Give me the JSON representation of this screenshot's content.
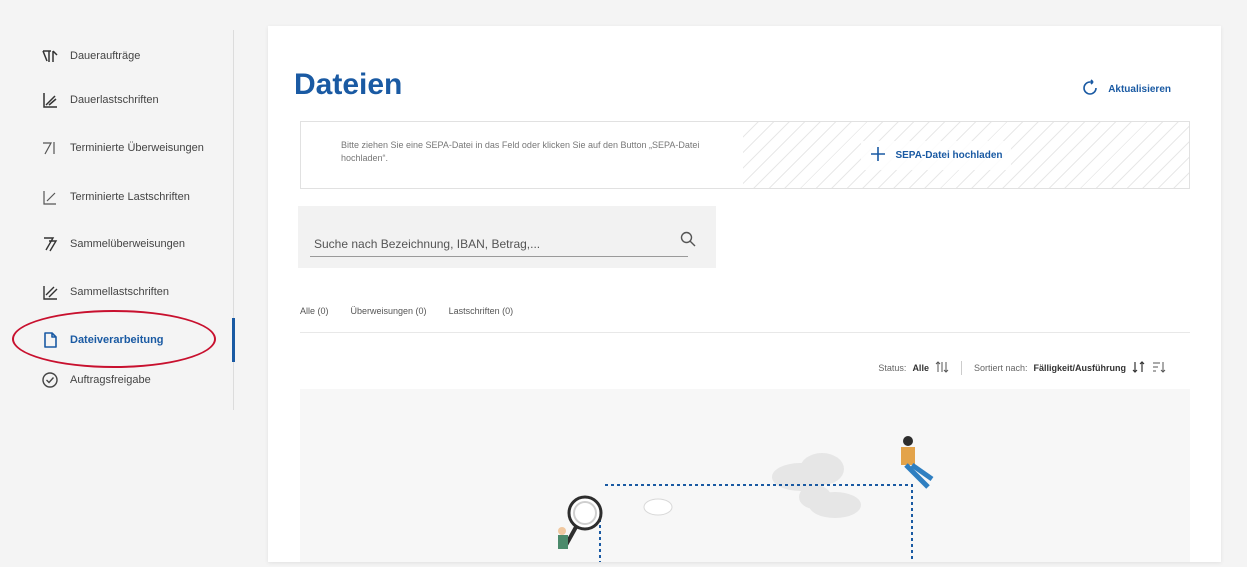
{
  "sidebar": {
    "items": [
      {
        "label": "Daueraufträge",
        "icon": "standing-order-icon"
      },
      {
        "label": "Dauerlastschriften",
        "icon": "standing-debit-icon"
      },
      {
        "label": "Terminierte Überweisungen",
        "icon": "scheduled-transfer-icon"
      },
      {
        "label": "Terminierte Lastschriften",
        "icon": "scheduled-debit-icon"
      },
      {
        "label": "Sammelüberweisungen",
        "icon": "bulk-transfer-icon"
      },
      {
        "label": "Sammellastschriften",
        "icon": "bulk-debit-icon"
      },
      {
        "label": "Dateiverarbeitung",
        "icon": "file-icon",
        "active": true
      },
      {
        "label": "Auftragsfreigabe",
        "icon": "check-circle-icon"
      }
    ]
  },
  "main": {
    "title": "Dateien",
    "refresh_label": "Aktualisieren",
    "dropzone": {
      "hint": "Bitte ziehen Sie eine SEPA-Datei in das Feld oder klicken Sie auf den Button „SEPA-Datei hochladen“.",
      "upload_label": "SEPA-Datei hochladen"
    },
    "search": {
      "placeholder": "Suche nach Bezeichnung, IBAN, Betrag,..."
    },
    "tabs": [
      {
        "label": "Alle (0)"
      },
      {
        "label": "Überweisungen (0)"
      },
      {
        "label": "Lastschriften (0)"
      }
    ],
    "filter": {
      "status_label": "Status:",
      "status_value": "Alle",
      "sort_label": "Sortiert nach:",
      "sort_value": "Fälligkeit/Ausführung"
    }
  },
  "colors": {
    "accent": "#1a5aa3",
    "highlight": "#c8102e"
  }
}
